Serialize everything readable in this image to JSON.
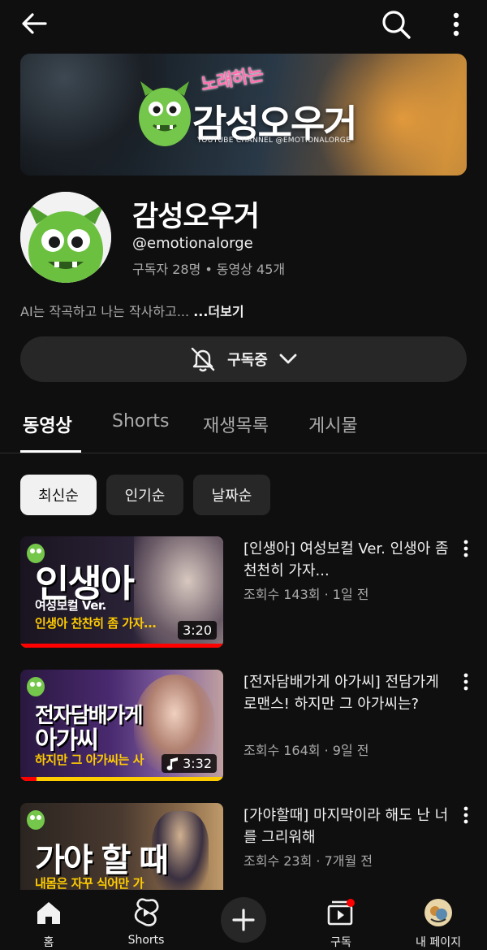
{
  "topbar": {
    "back_icon": "arrow-left-icon",
    "search_icon": "search-icon",
    "more_icon": "more-vertical-icon"
  },
  "banner": {
    "small_text": "노래하는",
    "big_text": "감성오우거",
    "sub_text": "YOUTUBE CHANNEL @EMOTIONALORGE"
  },
  "channel": {
    "name": "감성오우거",
    "handle": "@emotionalorge",
    "subscribers": "구독자 28명",
    "videos": "동영상 45개",
    "separator": "•",
    "description": "AI는 작곡하고 나는 작사하고... ",
    "more_label": "...더보기"
  },
  "subscribe_button": {
    "label": "구독중",
    "bell_icon": "bell-off-icon",
    "chevron_icon": "chevron-down-icon"
  },
  "tabs": [
    {
      "label": "동영상",
      "active": true
    },
    {
      "label": "Shorts",
      "active": false
    },
    {
      "label": "재생목록",
      "active": false
    },
    {
      "label": "게시물",
      "active": false
    }
  ],
  "chips": [
    {
      "label": "최신순",
      "active": true
    },
    {
      "label": "인기순",
      "active": false
    },
    {
      "label": "날짜순",
      "active": false
    }
  ],
  "videos": [
    {
      "thumb_big": "인생아",
      "thumb_line1": "여성보컬 Ver.",
      "thumb_line2": "인생아 찬찬히 좀 가자...",
      "duration": "3:20",
      "title": "[인생아] 여성보컬 Ver. 인생아 좀 천천히 가자...",
      "meta": "조회수 143회 · 1일 전",
      "progress": 1.0,
      "accent": "#ffcc00"
    },
    {
      "thumb_big1": "전자담배가게",
      "thumb_big2": "아가씨",
      "thumb_line": "하지만 그 아가씨는 사",
      "duration": "3:32",
      "title": "[전자담배가게 아가씨] 전담가게 로맨스! 하지만 그 아가씨는?",
      "meta": "조회수 164회 · 9일 전",
      "progress": 0.08,
      "accent": "#ffcc00"
    },
    {
      "thumb_big": "가야 할 때",
      "thumb_line": "내몸은 자꾸 식어만 가",
      "title": "[가야할때] 마지막이라 해도 난 너를 그리워해",
      "meta": "조회수 23회 · 7개월 전",
      "accent": "#ffcc00"
    }
  ],
  "bottom_nav": [
    {
      "label": "홈",
      "icon": "home-icon"
    },
    {
      "label": "Shorts",
      "icon": "shorts-icon"
    },
    {
      "label": "",
      "icon": "create-plus-icon"
    },
    {
      "label": "구독",
      "icon": "subscriptions-icon"
    },
    {
      "label": "내 페이지",
      "icon": "profile-avatar-icon"
    }
  ],
  "colors": {
    "background": "#0f0f0f",
    "chip_bg": "#272727",
    "secondary_text": "#aaaaaa",
    "accent_red": "#ff0000"
  }
}
